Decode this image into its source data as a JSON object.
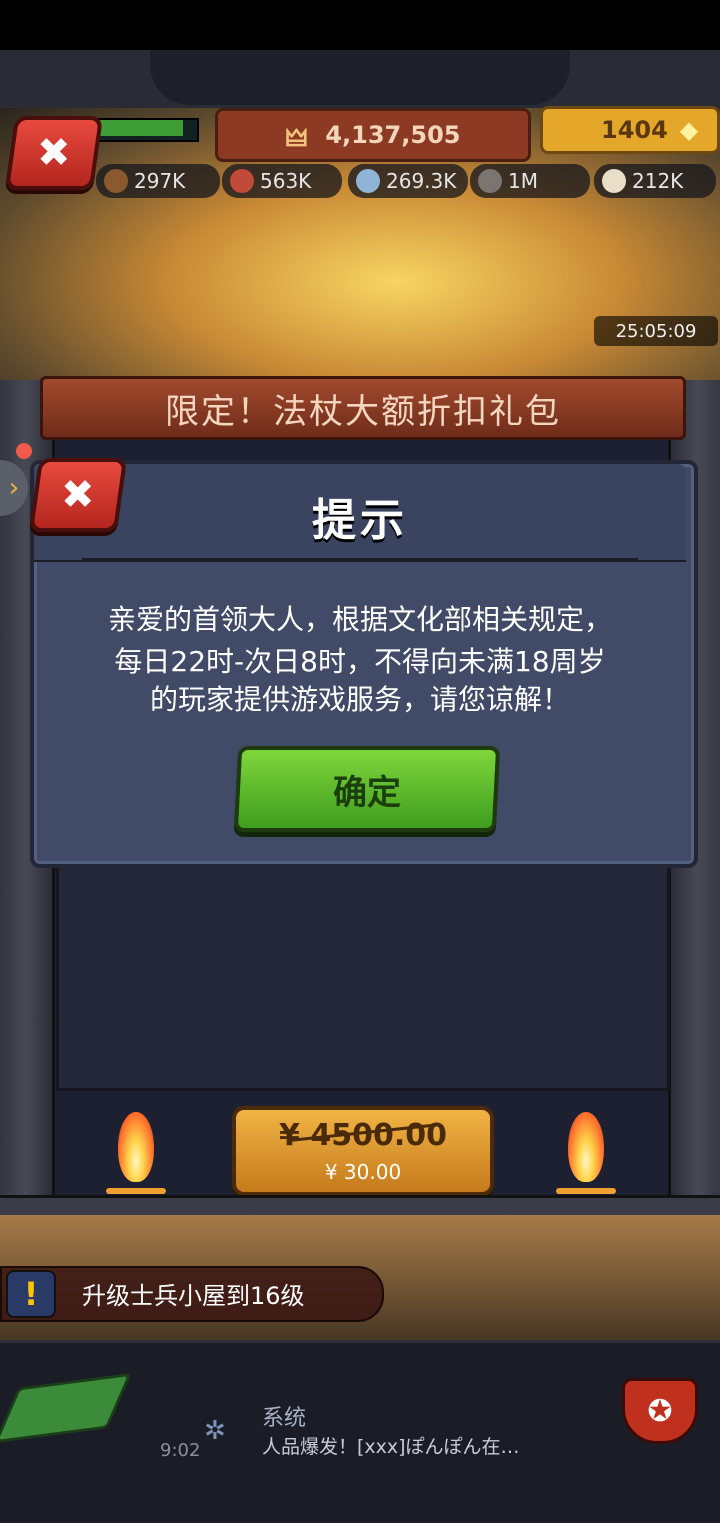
{
  "hud": {
    "trophy_value": "4,137,505",
    "gem_value": "1404",
    "resources": [
      {
        "icon": "wood-icon",
        "value": "297K"
      },
      {
        "icon": "meat-icon",
        "value": "563K"
      },
      {
        "icon": "water-drop-icon",
        "value": "269.3K"
      },
      {
        "icon": "stone-icon",
        "value": "1M"
      },
      {
        "icon": "bone-icon",
        "value": "212K"
      }
    ],
    "timer": "25:05:09",
    "xp_fraction": 0.9
  },
  "banner": {
    "text": "限定！法杖大额折扣礼包"
  },
  "dialog": {
    "title": "提示",
    "message_lines": [
      "亲爱的首领大人，根据文化部相关规定，",
      "每日22时-次日8时，不得向未满18周岁",
      "的玩家提供游戏服务，请您谅解！"
    ],
    "confirm_label": "确定"
  },
  "price": {
    "original": "¥ 4500.00",
    "current": "¥ 30.00"
  },
  "quest": {
    "text": "升级士兵小屋到16级",
    "icon_glyph": "!"
  },
  "chat": {
    "channel": "系统",
    "message": "人品爆发！[xxx]ぽんぽん在…",
    "time": "9:02"
  },
  "colors": {
    "confirm_green": "#5bbb2c",
    "close_red": "#d23a30",
    "price_orange": "#e2a03a",
    "dialog_bg": "#414a66"
  }
}
